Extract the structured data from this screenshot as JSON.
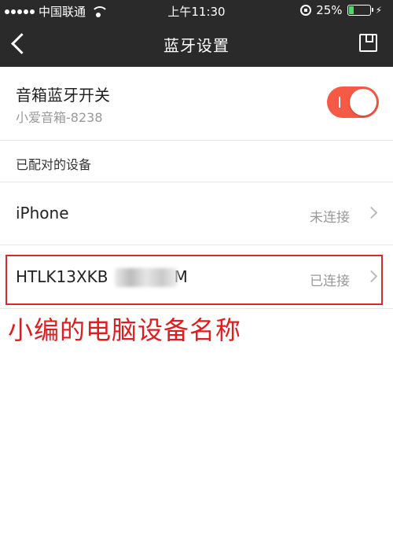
{
  "status_bar": {
    "carrier": "中国联通",
    "time": "上午11:30",
    "battery_percent": "25%",
    "battery_level": 0.25,
    "colors": {
      "battery": "#4cd964"
    }
  },
  "nav": {
    "title": "蓝牙设置",
    "back_icon": "chevron-left-icon",
    "save_icon": "save-icon"
  },
  "speaker_toggle": {
    "label": "音箱蓝牙开关",
    "subtitle": "小爱音箱-8238",
    "enabled": true,
    "color": "#f55a45"
  },
  "paired_section": {
    "title": "已配对的设备",
    "devices": [
      {
        "name": "iPhone",
        "status": "未连接"
      },
      {
        "name": "HTLK13XKB",
        "name_suffix": "M",
        "status": "已连接",
        "name_partially_blurred": true
      }
    ]
  },
  "annotation": {
    "text": "小编的电脑设备名称",
    "color": "#e01c1c"
  },
  "colors": {
    "header_bg": "#2a2a2a",
    "highlight_border": "#d62a2a"
  }
}
